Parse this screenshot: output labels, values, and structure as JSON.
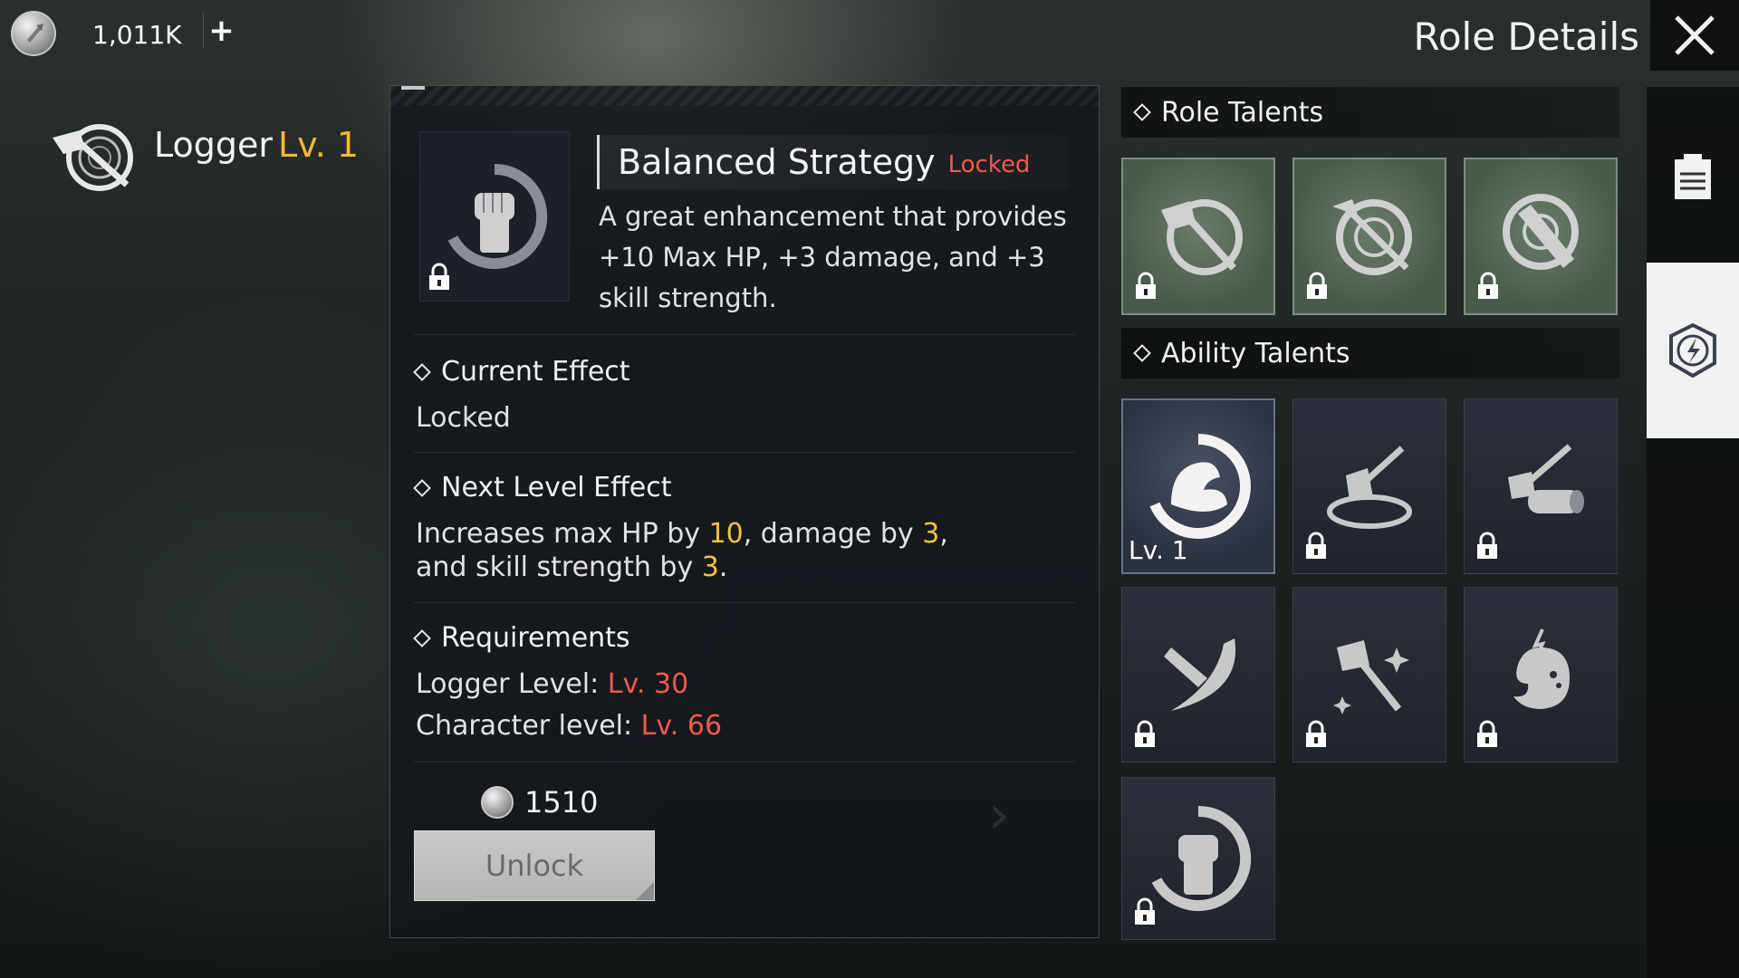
{
  "currency": {
    "amount": "1,011K",
    "add_label": "+"
  },
  "header": {
    "title": "Role Details"
  },
  "role": {
    "name": "Logger",
    "level": "Lv. 1"
  },
  "talent": {
    "name": "Balanced Strategy",
    "status": "Locked",
    "description": "A great enhancement that provides +10 Max HP, +3 damage, and +3 skill strength."
  },
  "current_effect": {
    "heading": "Current Effect",
    "value": "Locked"
  },
  "next_effect": {
    "heading": "Next Level Effect",
    "part1": "Increases max HP by ",
    "hp": "10",
    "part2": ", damage by ",
    "damage": "3",
    "part3": ", and skill strength by ",
    "skill": "3",
    "part4": "."
  },
  "requirements": {
    "heading": "Requirements",
    "logger_label": "Logger Level: ",
    "logger_value": "Lv. 30",
    "char_label": "Character level: ",
    "char_value": "Lv. 66"
  },
  "cost": {
    "amount": "1510"
  },
  "unlock_label": "Unlock",
  "role_talents": {
    "heading": "Role Talents"
  },
  "ability_talents": {
    "heading": "Ability Talents",
    "first_level": "Lv. 1"
  },
  "colors": {
    "accent_yellow": "#f5b733",
    "locked_red": "#ef5a4a"
  }
}
